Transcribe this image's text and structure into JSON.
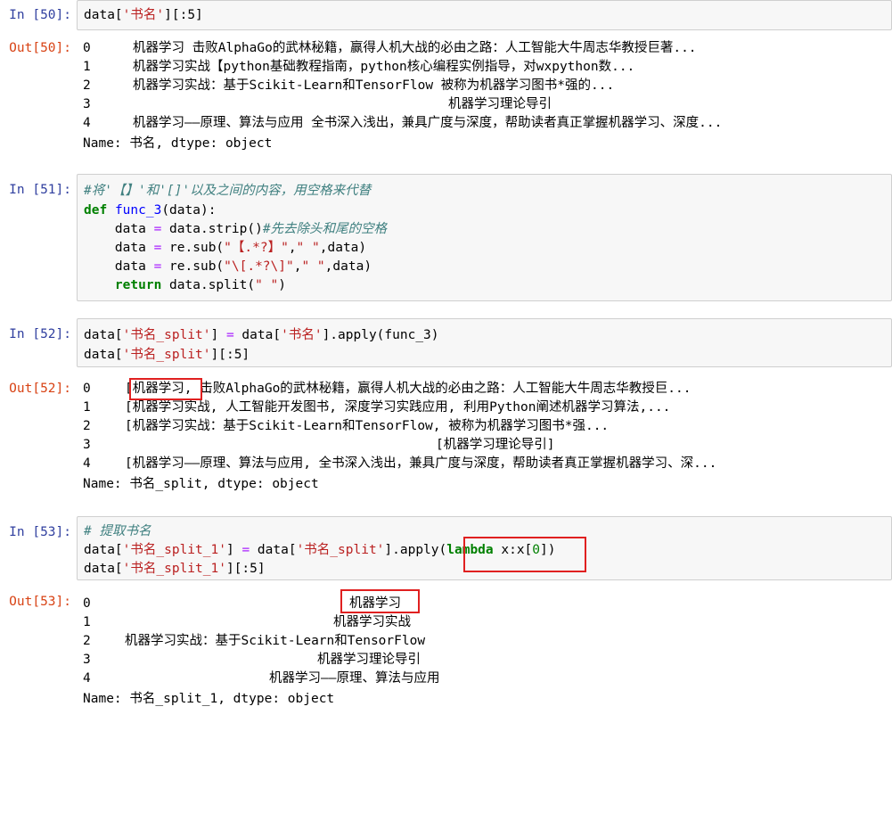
{
  "cells": [
    {
      "in_label": "In  [50]:",
      "code": [
        "data['书名'][:5]"
      ],
      "out_label": "Out[50]:",
      "out_rows": [
        {
          "idx": "0",
          "text": "机器学习 击败AlphaGo的武林秘籍，赢得人机大战的必由之路：人工智能大牛周志华教授巨著..."
        },
        {
          "idx": "1",
          "text": "机器学习实战【python基础教程指南，python核心编程实例指导，对wxpython数..."
        },
        {
          "idx": "2",
          "text": "机器学习实战：基于Scikit-Learn和TensorFlow 被称为机器学习图书*强的..."
        },
        {
          "idx": "3",
          "text": "机器学习理论导引"
        },
        {
          "idx": "4",
          "text": "机器学习——原理、算法与应用 全书深入浅出，兼具广度与深度，帮助读者真正掌握机器学习、深度..."
        }
      ],
      "footer": "Name: 书名, dtype: object"
    },
    {
      "in_label": "In  [51]:",
      "code": [
        "#将'【】'和'[]'以及之间的内容，用空格来代替",
        "def func_3(data):",
        "    data = data.strip()#先去除头和尾的空格",
        "    data = re.sub(\"【.*?】\",\" \",data)",
        "    data = re.sub(\"\\[.*?\\]\",\" \",data)",
        "    return data.split(\" \")"
      ]
    },
    {
      "in_label": "In  [52]:",
      "code": [
        "data['书名_split'] = data['书名'].apply(func_3)",
        "data['书名_split'][:5]"
      ],
      "out_label": "Out[52]:",
      "out_rows": [
        {
          "idx": "0",
          "text": "[机器学习, 击败AlphaGo的武林秘籍，赢得人机大战的必由之路：人工智能大牛周志华教授巨..."
        },
        {
          "idx": "1",
          "text": "[机器学习实战, 人工智能开发图书, 深度学习实践应用, 利用Python阐述机器学习算法,..."
        },
        {
          "idx": "2",
          "text": "[机器学习实战：基于Scikit-Learn和TensorFlow, 被称为机器学习图书*强..."
        },
        {
          "idx": "3",
          "text": "[机器学习理论导引]"
        },
        {
          "idx": "4",
          "text": "[机器学习——原理、算法与应用, 全书深入浅出，兼具广度与深度，帮助读者真正掌握机器学习、深..."
        }
      ],
      "footer": "Name: 书名_split, dtype: object"
    },
    {
      "in_label": "In  [53]:",
      "code": [
        "# 提取书名",
        "data['书名_split_1'] = data['书名_split'].apply(lambda x:x[0])",
        "data['书名_split_1'][:5]"
      ],
      "out_label": "Out[53]:",
      "out_rows": [
        {
          "idx": "0",
          "text": "机器学习"
        },
        {
          "idx": "1",
          "text": "机器学习实战"
        },
        {
          "idx": "2",
          "text": "机器学习实战：基于Scikit-Learn和TensorFlow"
        },
        {
          "idx": "3",
          "text": "机器学习理论导引"
        },
        {
          "idx": "4",
          "text": "机器学习——原理、算法与应用"
        }
      ],
      "footer": "Name: 书名_split_1, dtype: object"
    }
  ],
  "colors": {
    "in_prompt": "#303f9f",
    "out_prompt": "#d84315",
    "highlight": "#e02020",
    "cell_bg": "#f7f7f7"
  }
}
